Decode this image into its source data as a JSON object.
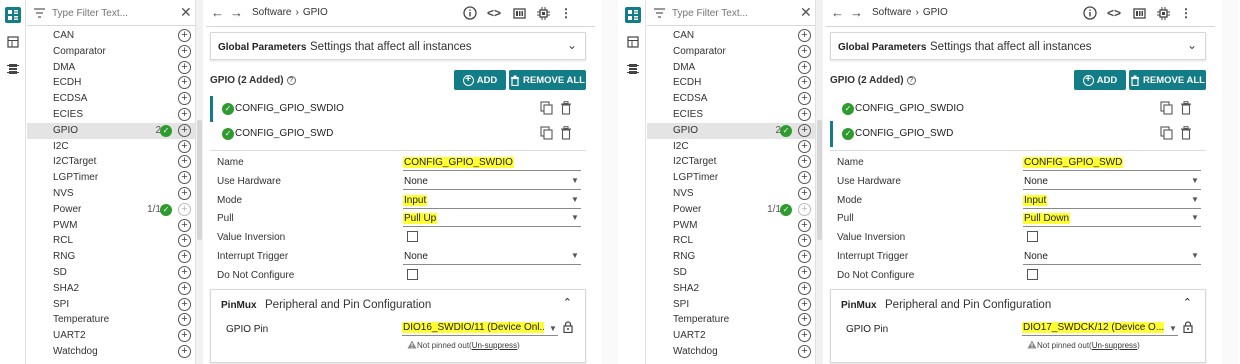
{
  "panels": [
    {
      "filter_placeholder": "Type Filter Text...",
      "modules": [
        {
          "label": "CAN",
          "count": "",
          "added": false,
          "dim": false,
          "sel": false
        },
        {
          "label": "Comparator",
          "count": "",
          "added": false,
          "dim": false,
          "sel": false
        },
        {
          "label": "DMA",
          "count": "",
          "added": false,
          "dim": false,
          "sel": false
        },
        {
          "label": "ECDH",
          "count": "",
          "added": false,
          "dim": false,
          "sel": false
        },
        {
          "label": "ECDSA",
          "count": "",
          "added": false,
          "dim": false,
          "sel": false
        },
        {
          "label": "ECIES",
          "count": "",
          "added": false,
          "dim": false,
          "sel": false
        },
        {
          "label": "GPIO",
          "count": "2",
          "added": true,
          "dim": false,
          "sel": true
        },
        {
          "label": "I2C",
          "count": "",
          "added": false,
          "dim": false,
          "sel": false
        },
        {
          "label": "I2CTarget",
          "count": "",
          "added": false,
          "dim": false,
          "sel": false
        },
        {
          "label": "LGPTimer",
          "count": "",
          "added": false,
          "dim": false,
          "sel": false
        },
        {
          "label": "NVS",
          "count": "",
          "added": false,
          "dim": false,
          "sel": false
        },
        {
          "label": "Power",
          "count": "1/1",
          "added": true,
          "dim": true,
          "sel": false
        },
        {
          "label": "PWM",
          "count": "",
          "added": false,
          "dim": false,
          "sel": false
        },
        {
          "label": "RCL",
          "count": "",
          "added": false,
          "dim": false,
          "sel": false
        },
        {
          "label": "RNG",
          "count": "",
          "added": false,
          "dim": false,
          "sel": false
        },
        {
          "label": "SD",
          "count": "",
          "added": false,
          "dim": false,
          "sel": false
        },
        {
          "label": "SHA2",
          "count": "",
          "added": false,
          "dim": false,
          "sel": false
        },
        {
          "label": "SPI",
          "count": "",
          "added": false,
          "dim": false,
          "sel": false
        },
        {
          "label": "Temperature",
          "count": "",
          "added": false,
          "dim": false,
          "sel": false
        },
        {
          "label": "UART2",
          "count": "",
          "added": false,
          "dim": false,
          "sel": false
        },
        {
          "label": "Watchdog",
          "count": "",
          "added": false,
          "dim": false,
          "sel": false
        }
      ],
      "breadcrumb": [
        "Software",
        "›",
        "GPIO"
      ],
      "global": {
        "title": "Global Parameters",
        "desc": "Settings that affect all instances"
      },
      "gpio_header": "GPIO (2 Added)",
      "add_label": "ADD",
      "remove_all_label": "REMOVE ALL",
      "instances": [
        {
          "name": "CONFIG_GPIO_SWDIO",
          "selected": true
        },
        {
          "name": "CONFIG_GPIO_SWD",
          "selected": false
        }
      ],
      "props": [
        {
          "label": "Name",
          "value": "CONFIG_GPIO_SWDIO",
          "type": "text",
          "hl": true
        },
        {
          "label": "Use Hardware",
          "value": "None",
          "type": "select",
          "hl": false
        },
        {
          "label": "Mode",
          "value": "Input",
          "type": "select",
          "hl": true
        },
        {
          "label": "Pull",
          "value": "Pull Up",
          "type": "select",
          "hl": true
        },
        {
          "label": "Value Inversion",
          "value": "",
          "type": "check",
          "hl": false
        },
        {
          "label": "Interrupt Trigger",
          "value": "None",
          "type": "select",
          "hl": false
        },
        {
          "label": "Do Not Configure",
          "value": "",
          "type": "check",
          "hl": false
        }
      ],
      "pinmux": {
        "title": "PinMux",
        "desc": "Peripheral and Pin Configuration",
        "pin_label": "GPIO Pin",
        "pin_value": "DIO16_SWDIO/11 (Device Onl...",
        "warning_prefix": "Not pinned out(",
        "warning_link": "Un-suppress",
        "warning_suffix": ")"
      }
    },
    {
      "filter_placeholder": "Type Filter Text...",
      "modules": [
        {
          "label": "CAN",
          "count": "",
          "added": false,
          "dim": false,
          "sel": false
        },
        {
          "label": "Comparator",
          "count": "",
          "added": false,
          "dim": false,
          "sel": false
        },
        {
          "label": "DMA",
          "count": "",
          "added": false,
          "dim": false,
          "sel": false
        },
        {
          "label": "ECDH",
          "count": "",
          "added": false,
          "dim": false,
          "sel": false
        },
        {
          "label": "ECDSA",
          "count": "",
          "added": false,
          "dim": false,
          "sel": false
        },
        {
          "label": "ECIES",
          "count": "",
          "added": false,
          "dim": false,
          "sel": false
        },
        {
          "label": "GPIO",
          "count": "2",
          "added": true,
          "dim": false,
          "sel": true
        },
        {
          "label": "I2C",
          "count": "",
          "added": false,
          "dim": false,
          "sel": false
        },
        {
          "label": "I2CTarget",
          "count": "",
          "added": false,
          "dim": false,
          "sel": false
        },
        {
          "label": "LGPTimer",
          "count": "",
          "added": false,
          "dim": false,
          "sel": false
        },
        {
          "label": "NVS",
          "count": "",
          "added": false,
          "dim": false,
          "sel": false
        },
        {
          "label": "Power",
          "count": "1/1",
          "added": true,
          "dim": true,
          "sel": false
        },
        {
          "label": "PWM",
          "count": "",
          "added": false,
          "dim": false,
          "sel": false
        },
        {
          "label": "RCL",
          "count": "",
          "added": false,
          "dim": false,
          "sel": false
        },
        {
          "label": "RNG",
          "count": "",
          "added": false,
          "dim": false,
          "sel": false
        },
        {
          "label": "SD",
          "count": "",
          "added": false,
          "dim": false,
          "sel": false
        },
        {
          "label": "SHA2",
          "count": "",
          "added": false,
          "dim": false,
          "sel": false
        },
        {
          "label": "SPI",
          "count": "",
          "added": false,
          "dim": false,
          "sel": false
        },
        {
          "label": "Temperature",
          "count": "",
          "added": false,
          "dim": false,
          "sel": false
        },
        {
          "label": "UART2",
          "count": "",
          "added": false,
          "dim": false,
          "sel": false
        },
        {
          "label": "Watchdog",
          "count": "",
          "added": false,
          "dim": false,
          "sel": false
        }
      ],
      "breadcrumb": [
        "Software",
        "›",
        "GPIO"
      ],
      "global": {
        "title": "Global Parameters",
        "desc": "Settings that affect all instances"
      },
      "gpio_header": "GPIO (2 Added)",
      "add_label": "ADD",
      "remove_all_label": "REMOVE ALL",
      "instances": [
        {
          "name": "CONFIG_GPIO_SWDIO",
          "selected": false
        },
        {
          "name": "CONFIG_GPIO_SWD",
          "selected": true
        }
      ],
      "props": [
        {
          "label": "Name",
          "value": "CONFIG_GPIO_SWD",
          "type": "text",
          "hl": true
        },
        {
          "label": "Use Hardware",
          "value": "None",
          "type": "select",
          "hl": false
        },
        {
          "label": "Mode",
          "value": "Input",
          "type": "select",
          "hl": true
        },
        {
          "label": "Pull",
          "value": "Pull Down",
          "type": "select",
          "hl": true
        },
        {
          "label": "Value Inversion",
          "value": "",
          "type": "check",
          "hl": false
        },
        {
          "label": "Interrupt Trigger",
          "value": "None",
          "type": "select",
          "hl": false
        },
        {
          "label": "Do Not Configure",
          "value": "",
          "type": "check",
          "hl": false
        }
      ],
      "pinmux": {
        "title": "PinMux",
        "desc": "Peripheral and Pin Configuration",
        "pin_label": "GPIO Pin",
        "pin_value": "DIO17_SWDCK/12 (Device O...",
        "warning_prefix": "Not pinned out(",
        "warning_link": "Un-suppress",
        "warning_suffix": ")"
      }
    }
  ],
  "colors": {
    "accent": "#127c87",
    "check": "#2e9b2e",
    "highlight": "#ffff33"
  },
  "icons": [
    "software-view-icon",
    "board-view-icon",
    "chip-view-icon",
    "filter-icon",
    "close-icon",
    "back-arrow-icon",
    "forward-arrow-icon",
    "info-icon",
    "code-icon",
    "memory-icon",
    "settings-chip-icon",
    "more-icon",
    "chevron-down-icon",
    "chevron-up-icon",
    "check-icon",
    "add-circle-icon",
    "copy-icon",
    "delete-icon",
    "lock-icon",
    "warning-icon",
    "help-icon"
  ]
}
